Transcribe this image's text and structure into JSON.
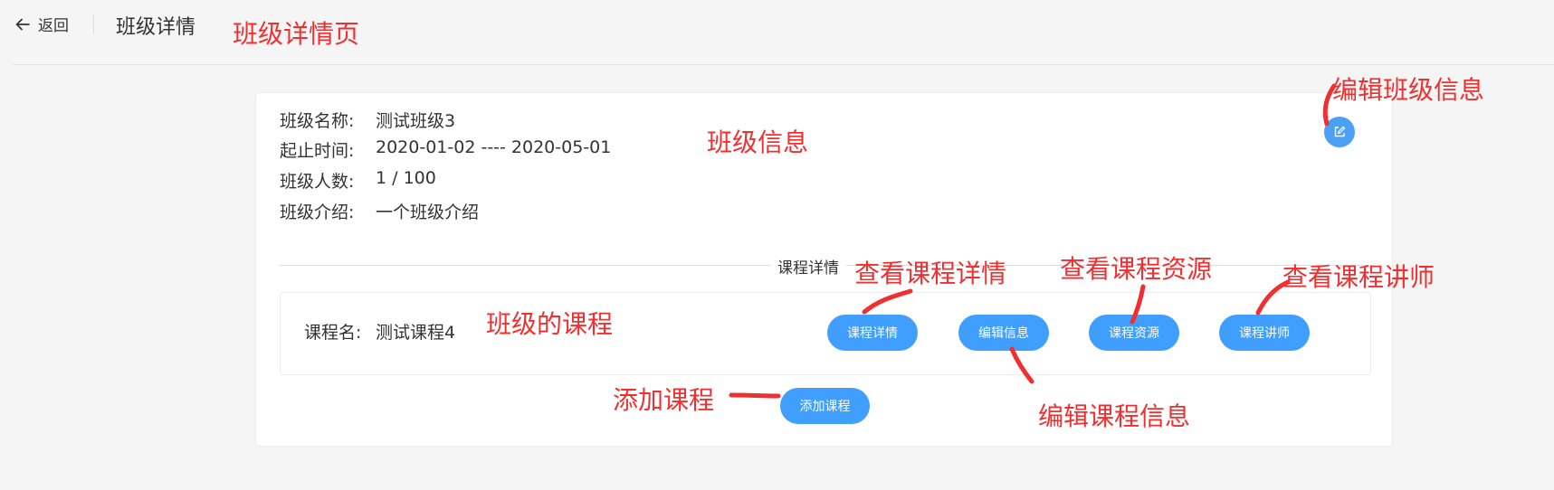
{
  "header": {
    "back_label": "返回",
    "title": "班级详情"
  },
  "class_info": {
    "rows": [
      {
        "label": "班级名称:",
        "value": "测试班级3"
      },
      {
        "label": "起止时间:",
        "value": "2020-01-02 ---- 2020-05-01"
      },
      {
        "label": "班级人数:",
        "value": "1 / 100"
      },
      {
        "label": "班级介绍:",
        "value": "一个班级介绍"
      }
    ]
  },
  "courses_section": {
    "divider_label": "课程详情",
    "course": {
      "label": "课程名:",
      "name": "测试课程4"
    },
    "buttons": {
      "detail": "课程详情",
      "edit": "编辑信息",
      "resources": "课程资源",
      "lecturers": "课程讲师"
    },
    "add_course": "添加课程"
  },
  "annotations": {
    "page": "班级详情页",
    "edit_class": "编辑班级信息",
    "class_info": "班级信息",
    "view_detail": "查看课程详情",
    "view_resources": "查看课程资源",
    "view_lecturers": "查看课程讲师",
    "class_courses": "班级的课程",
    "add_course": "添加课程",
    "edit_course": "编辑课程信息"
  },
  "colors": {
    "primary": "#409eff",
    "annotation": "#f03030"
  },
  "icons": {
    "back": "arrow-left-icon",
    "edit": "edit-icon"
  }
}
